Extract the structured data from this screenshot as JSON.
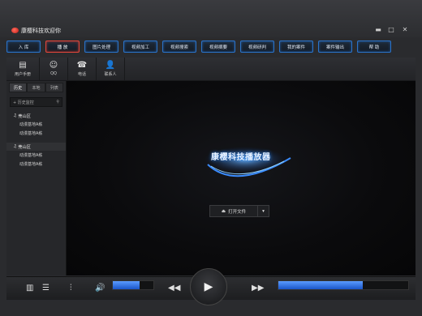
{
  "window": {
    "title": "康樱科技欢迎你"
  },
  "menu": [
    "入 库",
    "播 放",
    "图片处理",
    "视频加工",
    "视频搜索",
    "视频摘要",
    "视频研判",
    "我的案件",
    "案件输出",
    "帮 助"
  ],
  "active_menu_index": 1,
  "toolbar": {
    "tools": [
      {
        "label": "用户手册",
        "icon": "manual-icon"
      },
      {
        "label": "QQ",
        "icon": "qq-icon"
      },
      {
        "label": "电话",
        "icon": "phone-icon"
      },
      {
        "label": "联系人",
        "icon": "contact-icon"
      }
    ]
  },
  "sidebar": {
    "tabs": [
      "历史",
      "本地",
      "列表"
    ],
    "active_tab": 0,
    "search_label": "历史监控",
    "groups": [
      {
        "title": "莞山区",
        "items": [
          "动漫基地A栋",
          "动漫基地A栋"
        ]
      },
      {
        "title": "莞山区",
        "items": [
          "动漫基地A栋",
          "动漫基地A栋"
        ]
      }
    ]
  },
  "player": {
    "brand": "康樱科技播放器",
    "open_file": "打开文件",
    "volume_level": 0.65,
    "progress": 0.65
  },
  "colors": {
    "accent": "#2a73c9",
    "active_menu": "#e2463a",
    "fill": "#2f7bff"
  }
}
